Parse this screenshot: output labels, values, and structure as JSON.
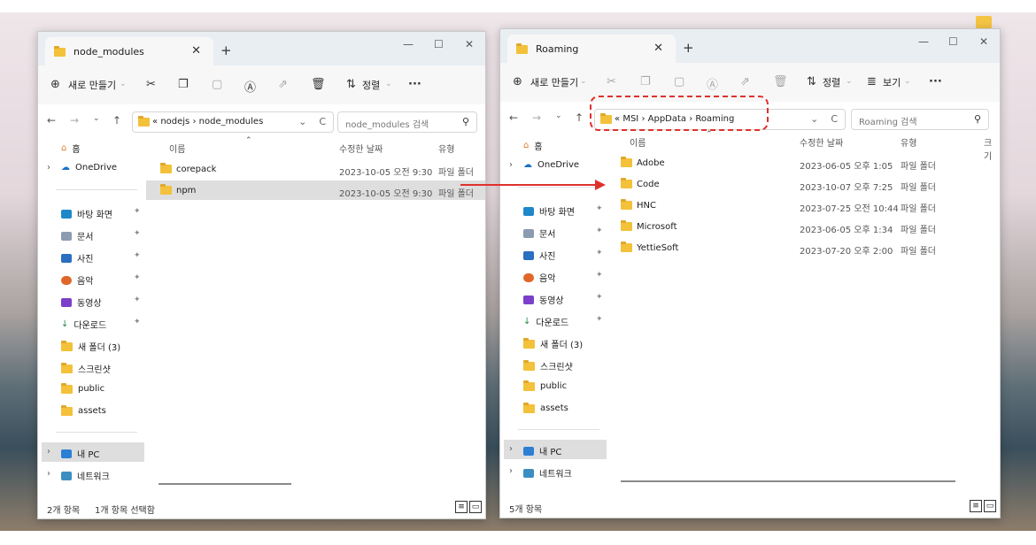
{
  "left": {
    "tab_title": "node_modules",
    "toolbar": {
      "new": "새로 만들기",
      "sort": "정렬"
    },
    "path": {
      "prefix": "«",
      "segments": [
        "nodejs",
        "node_modules"
      ]
    },
    "search_placeholder": "node_modules 검색",
    "columns": {
      "name": "이름",
      "date": "수정한 날짜",
      "type": "유형"
    },
    "files": [
      {
        "name": "corepack",
        "date": "2023-10-05 오전 9:30",
        "type": "파일 폴더"
      },
      {
        "name": "npm",
        "date": "2023-10-05 오전 9:30",
        "type": "파일 폴더"
      }
    ],
    "status_count": "2개 항목",
    "status_selected": "1개 항목 선택함"
  },
  "right": {
    "tab_title": "Roaming",
    "toolbar": {
      "new": "새로 만들기",
      "sort": "정렬",
      "view": "보기"
    },
    "path": {
      "prefix": "«",
      "segments": [
        "MSI",
        "AppData",
        "Roaming"
      ]
    },
    "search_placeholder": "Roaming 검색",
    "columns": {
      "name": "이름",
      "date": "수정한 날짜",
      "type": "유형",
      "size": "크기"
    },
    "files": [
      {
        "name": "Adobe",
        "date": "2023-06-05 오후 1:05",
        "type": "파일 폴더"
      },
      {
        "name": "Code",
        "date": "2023-10-07 오후 7:25",
        "type": "파일 폴더"
      },
      {
        "name": "HNC",
        "date": "2023-07-25 오전 10:44",
        "type": "파일 폴더"
      },
      {
        "name": "Microsoft",
        "date": "2023-06-05 오후 1:34",
        "type": "파일 폴더"
      },
      {
        "name": "YettieSoft",
        "date": "2023-07-20 오후 2:00",
        "type": "파일 폴더"
      }
    ],
    "status_count": "5개 항목"
  },
  "nav_items": {
    "home": "홈",
    "onedrive": "OneDrive",
    "desktop": "바탕 화면",
    "documents": "문서",
    "pictures": "사진",
    "music": "음악",
    "videos": "동영상",
    "downloads": "다운로드",
    "new_folder": "새 폴더 (3)",
    "screenshots": "스크린샷",
    "public": "public",
    "assets": "assets",
    "this_pc": "내 PC",
    "network": "네트워크"
  },
  "colors": {
    "folder": "#f3c13a",
    "highlight": "#e0312c",
    "selected_row": "#dedede"
  }
}
